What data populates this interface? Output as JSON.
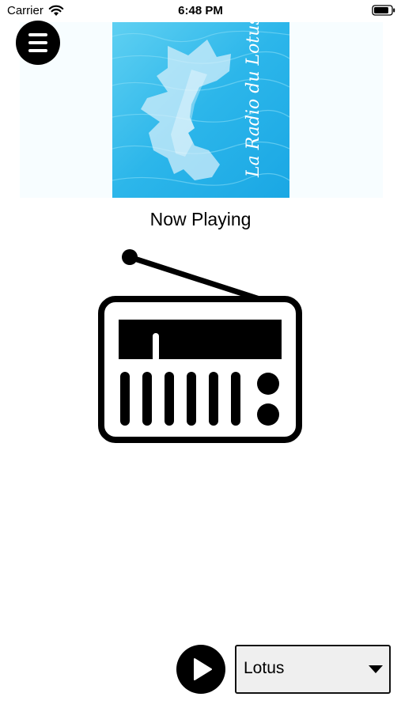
{
  "status_bar": {
    "carrier": "Carrier",
    "time": "6:48 PM",
    "wifi_icon": "wifi-icon",
    "battery_icon": "battery-icon"
  },
  "header": {
    "menu_icon": "menu-icon",
    "cover_title": "La Radio du Lotus",
    "cover_colors": {
      "water_light": "#5fd0f2",
      "water_dark": "#1aa7e4",
      "face": "#d8f0fb"
    }
  },
  "main": {
    "now_playing": "Now Playing",
    "radio_icon": "radio-icon"
  },
  "player": {
    "play_icon": "play-icon",
    "station_value": "Lotus",
    "dropdown_icon": "chevron-down-icon"
  },
  "colors": {
    "background": "#ffffff",
    "header_bg": "#f7fdff",
    "control_fill": "#000000",
    "select_bg": "#efefef"
  }
}
